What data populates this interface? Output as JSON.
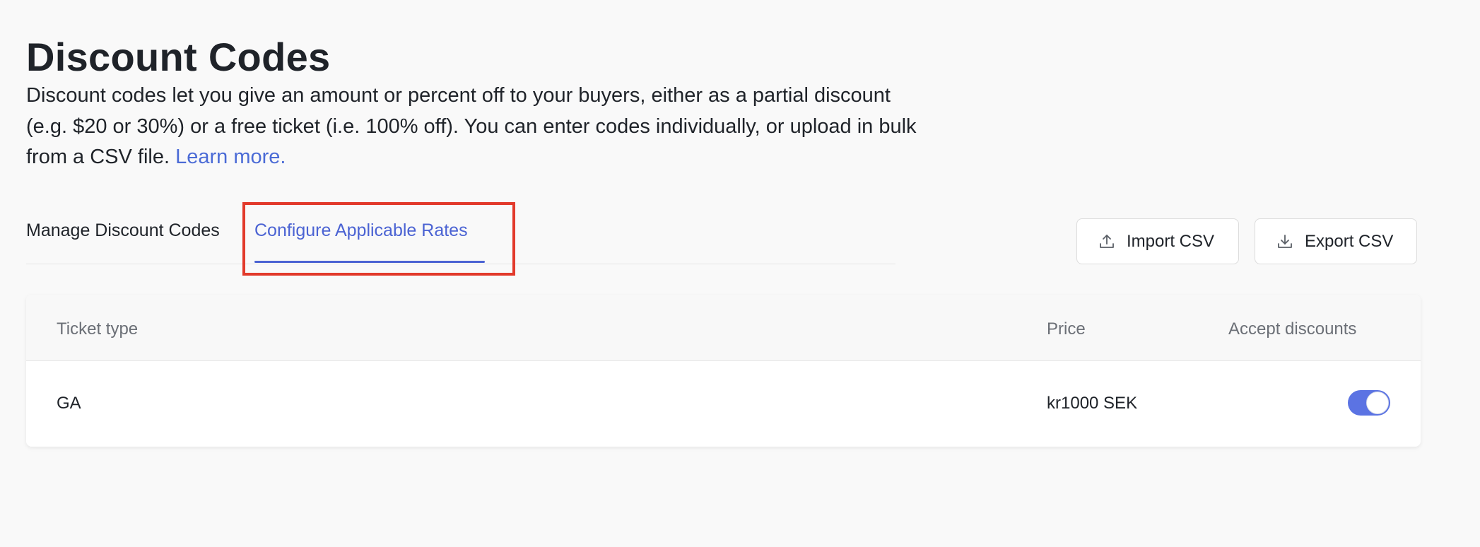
{
  "page": {
    "title": "Discount Codes",
    "description": "Discount codes let you give an amount or percent off to your buyers, either as a partial discount (e.g. $20 or 30%) or a free ticket (i.e. 100% off). You can enter codes individually, or upload in bulk from a CSV file.",
    "learn_more": "Learn more."
  },
  "tabs": [
    {
      "label": "Manage Discount Codes",
      "active": false
    },
    {
      "label": "Configure Applicable Rates",
      "active": true
    }
  ],
  "toolbar": {
    "import_label": "Import CSV",
    "import_icon": "upload-icon",
    "export_label": "Export CSV",
    "export_icon": "download-icon"
  },
  "table": {
    "columns": [
      "Ticket type",
      "Price",
      "Accept discounts"
    ],
    "rows": [
      {
        "ticket_type": "GA",
        "price": "kr1000 SEK",
        "accept_discounts": true
      }
    ]
  },
  "colors": {
    "accent": "#4b63d3",
    "toggle_on": "#5b73e3",
    "highlight": "#e23a2b"
  }
}
